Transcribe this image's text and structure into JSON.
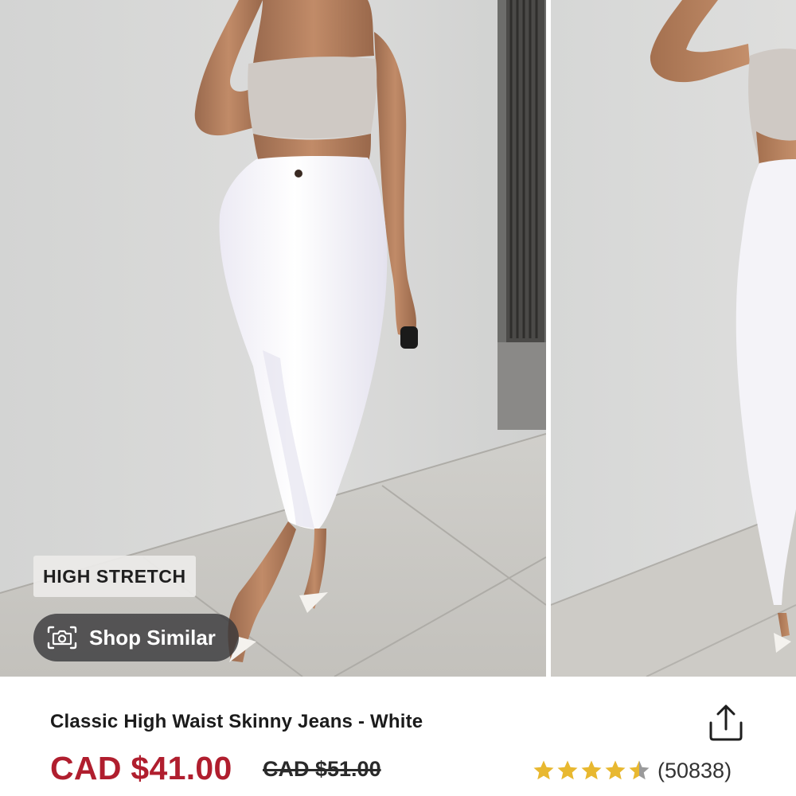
{
  "carousel": {
    "badge": "HIGH STRETCH",
    "shop_similar_label": "Shop Similar"
  },
  "product": {
    "title": "Classic High Waist Skinny Jeans - White",
    "price": "CAD $41.00",
    "original_price": "CAD $51.00",
    "rating": 4.5,
    "review_count": "(50838)"
  },
  "icons": {
    "share": "share-icon",
    "camera": "camera-icon",
    "star": "star-icon"
  },
  "colors": {
    "price": "#b01e2e",
    "star": "#e8b830",
    "star_empty": "#9a9a9a"
  }
}
